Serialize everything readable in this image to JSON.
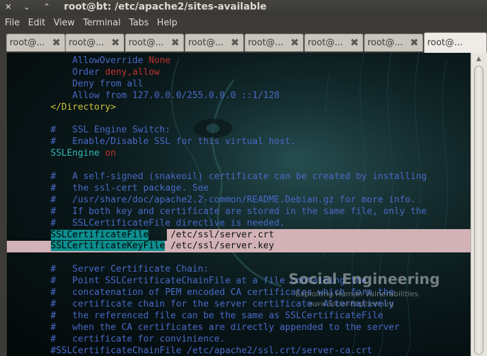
{
  "window": {
    "title": "root@bt: /etc/apache2/sites-available",
    "controls": {
      "close": "✕",
      "minimize": "⌄",
      "maximize": "⌃"
    }
  },
  "menu": [
    "File",
    "Edit",
    "View",
    "Terminal",
    "Tabs",
    "Help"
  ],
  "tabs": [
    {
      "label": "root@...",
      "active": false
    },
    {
      "label": "root@...",
      "active": false
    },
    {
      "label": "root@...",
      "active": false
    },
    {
      "label": "root@...",
      "active": false
    },
    {
      "label": "root@...",
      "active": false
    },
    {
      "label": "root@...",
      "active": false
    },
    {
      "label": "root@...",
      "active": false
    },
    {
      "label": "root@...",
      "active": true
    }
  ],
  "terminal": {
    "lines": [
      [
        {
          "t": "            AllowOverride ",
          "c": "c-blue"
        },
        {
          "t": "None",
          "c": "c-red"
        }
      ],
      [
        {
          "t": "            Order ",
          "c": "c-blue"
        },
        {
          "t": "deny,allow",
          "c": "c-red"
        }
      ],
      [
        {
          "t": "            Deny from all",
          "c": "c-blue"
        }
      ],
      [
        {
          "t": "            Allow from 127.0.0.0/255.0.0.0 ::1/128",
          "c": "c-blue"
        }
      ],
      [
        {
          "t": "        </Directory>",
          "c": "c-yellow"
        }
      ],
      [
        {
          "t": "",
          "c": "c-blue"
        }
      ],
      [
        {
          "t": "        #   SSL Engine Switch:",
          "c": "c-blue"
        }
      ],
      [
        {
          "t": "        #   Enable/Disable SSL for this virtual host.",
          "c": "c-blue"
        }
      ],
      [
        {
          "t": "        SSLEngine ",
          "c": "c-cyan"
        },
        {
          "t": "on",
          "c": "c-red"
        }
      ],
      [
        {
          "t": "",
          "c": "c-blue"
        }
      ],
      [
        {
          "t": "        #   A self-signed (snakeoil) certificate can be created by installing",
          "c": "c-blue"
        }
      ],
      [
        {
          "t": "        #   the ssl-cert package. See",
          "c": "c-blue"
        }
      ],
      [
        {
          "t": "        #   /usr/share/doc/apache2.2-common/README.Debian.gz for more info.",
          "c": "c-blue"
        }
      ],
      [
        {
          "t": "        #   If both key and certificate are stored in the same file, only the",
          "c": "c-blue"
        }
      ],
      [
        {
          "t": "        #   SSLCertificateFile directive is needed.",
          "c": "c-blue"
        }
      ],
      [
        {
          "t": "        ",
          "c": "c-blue"
        },
        {
          "t": "SSLCertificateFile",
          "c": "hl-cyan"
        },
        {
          "t": "    /etc/ssl/server.crt",
          "c": "c-dark"
        }
      ],
      [
        {
          "t": "        ",
          "c": "c-blue"
        },
        {
          "t": "SSLCertificateKeyFile",
          "c": "hl-cyan"
        },
        {
          "t": " /etc/ssl/server.key",
          "c": "c-dark"
        }
      ],
      [
        {
          "t": "",
          "c": "c-blue"
        }
      ],
      [
        {
          "t": "        #   Server Certificate Chain:",
          "c": "c-blue"
        }
      ],
      [
        {
          "t": "        #   Point SSLCertificateChainFile at a file containing the",
          "c": "c-blue"
        }
      ],
      [
        {
          "t": "        #   concatenation of PEM encoded CA certificates which form the",
          "c": "c-blue"
        }
      ],
      [
        {
          "t": "        #   certificate chain for the server certificate. Alternatively",
          "c": "c-blue"
        }
      ],
      [
        {
          "t": "        #   the referenced file can be the same as SSLCertificateFile",
          "c": "c-blue"
        }
      ],
      [
        {
          "t": "        #   when the CA certificates are directly appended to the server",
          "c": "c-blue"
        }
      ],
      [
        {
          "t": "        #   certificate for convinience.",
          "c": "c-blue"
        }
      ],
      [
        {
          "t": "        #SSLCertificateChainFile /etc/apache2/ssl.crt/server-ca.crt",
          "c": "c-blue"
        }
      ]
    ],
    "watermark": {
      "title": "Social Engineering",
      "subtitle": "Exploiting Human Vulnerabilities",
      "url": "www.Social-Engineer.org"
    }
  },
  "scrollbar": {
    "up_arrow": "▲"
  }
}
